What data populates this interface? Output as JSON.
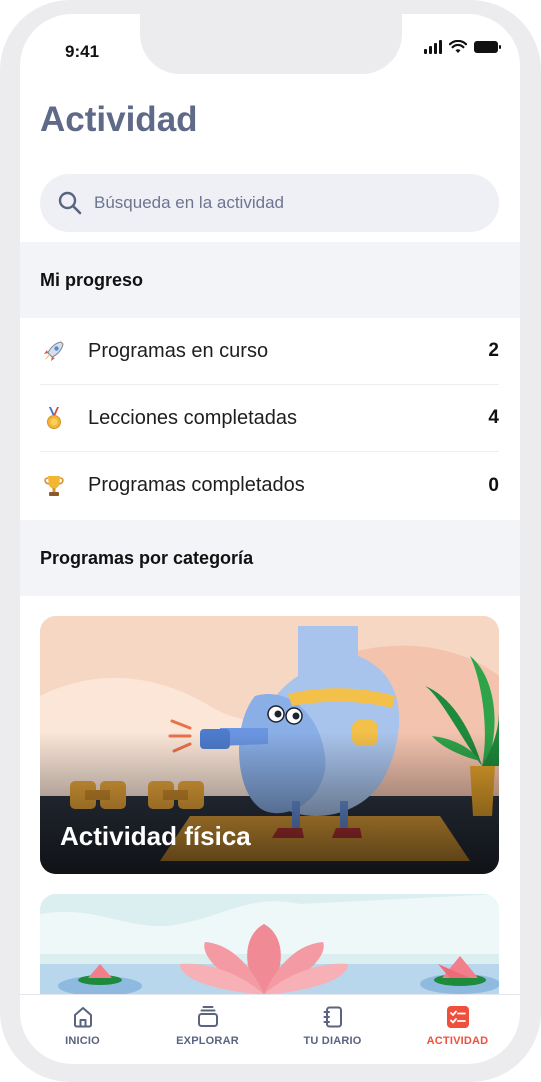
{
  "status_bar": {
    "time": "9:41"
  },
  "header": {
    "title": "Actividad"
  },
  "search": {
    "placeholder": "Búsqueda en la actividad"
  },
  "progress": {
    "heading": "Mi progreso",
    "rows": [
      {
        "label": "Programas en curso",
        "value": "2",
        "icon": "rocket-icon"
      },
      {
        "label": "Lecciones completadas",
        "value": "4",
        "icon": "medal-icon"
      },
      {
        "label": "Programas completados",
        "value": "0",
        "icon": "trophy-icon"
      }
    ]
  },
  "categories": {
    "heading": "Programas por categoría",
    "cards": [
      {
        "title": "Actividad física"
      }
    ]
  },
  "bottom_nav": {
    "items": [
      {
        "label": "INICIO",
        "icon": "home-icon"
      },
      {
        "label": "EXPLORAR",
        "icon": "stack-icon"
      },
      {
        "label": "TU DIARIO",
        "icon": "journal-icon"
      },
      {
        "label": "ACTIVIDAD",
        "icon": "activity-checklist-icon"
      }
    ],
    "active_index": 3
  },
  "colors": {
    "accent": "#f04f3c",
    "title": "#5f6988",
    "nav_inactive": "#5a6380"
  }
}
